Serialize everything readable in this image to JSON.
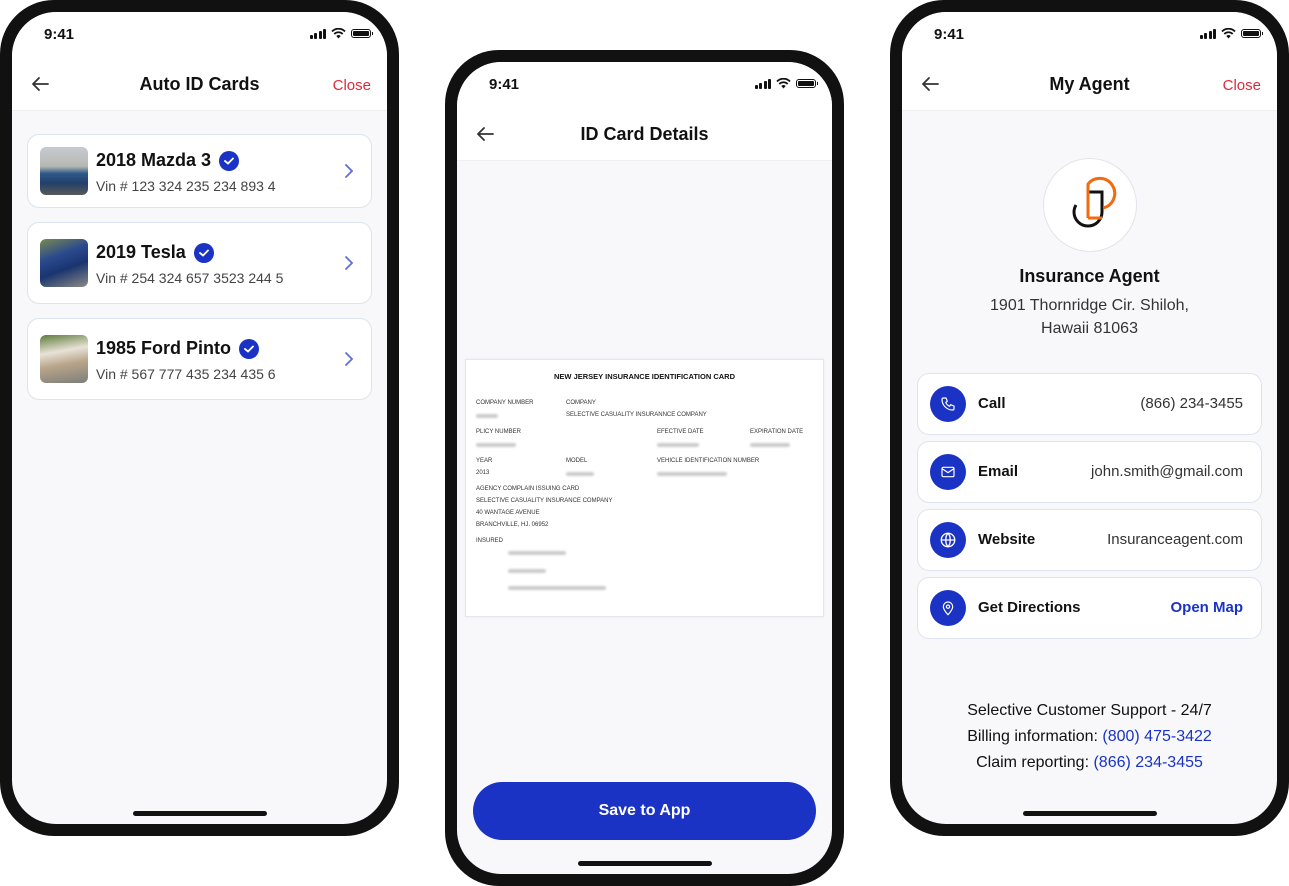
{
  "status_bar": {
    "time": "9:41"
  },
  "screen_auto_id": {
    "title": "Auto ID Cards",
    "close_label": "Close",
    "vehicles": [
      {
        "name": "2018 Mazda 3",
        "vin": "Vin # 123 324 235 234 893 4",
        "verified": true
      },
      {
        "name": "2019 Tesla",
        "vin": "Vin # 254 324 657 3523 244 5",
        "verified": true
      },
      {
        "name": "1985 Ford Pinto",
        "vin": "Vin # 567 777 435 234 435 6",
        "verified": true
      }
    ]
  },
  "screen_id_details": {
    "title": "ID Card Details",
    "card": {
      "heading": "NEW JERSEY INSURANCE IDENTIFICATION CARD",
      "company_number_label": "COMPANY NUMBER",
      "company_label": "COMPANY",
      "company_value": "SELECTIVE CASUALITY INSURANNCE COMPANY",
      "policy_number_label": "PLICY NUMBER",
      "effective_date_label": "EFECTIVE DATE",
      "expiration_date_label": "EXPIRATION DATE",
      "year_label": "YEAR",
      "year_value": "2013",
      "model_label": "MODEL",
      "vin_label": "VEHICLE  IDENTIFICATION NUMBER",
      "agency_label": "AGENCY COMPLAIN ISSUING CARD",
      "agency_lines": [
        "SELECTIVE CASUALITY INSURANCE COMPANY",
        "40 WANTAGE AVENUE",
        "BRANCHVILLE, HJ. 06952"
      ],
      "insured_label": "INSURED"
    },
    "save_label": "Save to App"
  },
  "screen_agent": {
    "title": "My Agent",
    "close_label": "Close",
    "agent_name": "Insurance Agent",
    "address_line1": "1901 Thornridge Cir. Shiloh,",
    "address_line2": "Hawaii 81063",
    "contacts": [
      {
        "icon": "phone-icon",
        "label": "Call",
        "value": "(866) 234-3455"
      },
      {
        "icon": "mail-icon",
        "label": "Email",
        "value": "john.smith@gmail.com"
      },
      {
        "icon": "globe-icon",
        "label": "Website",
        "value": "Insuranceagent.com"
      },
      {
        "icon": "map-pin-icon",
        "label": "Get Directions",
        "value": "Open Map"
      }
    ],
    "support": {
      "line1": "Selective Customer Support - 24/7",
      "billing_label": "Billing information: ",
      "billing_phone": "(800) 475-3422",
      "claim_label": "Claim reporting: ",
      "claim_phone": "(866) 234-3455"
    }
  },
  "colors": {
    "accent": "#1a33c4",
    "close": "#e0293b",
    "logo_orange": "#f26b0f"
  }
}
